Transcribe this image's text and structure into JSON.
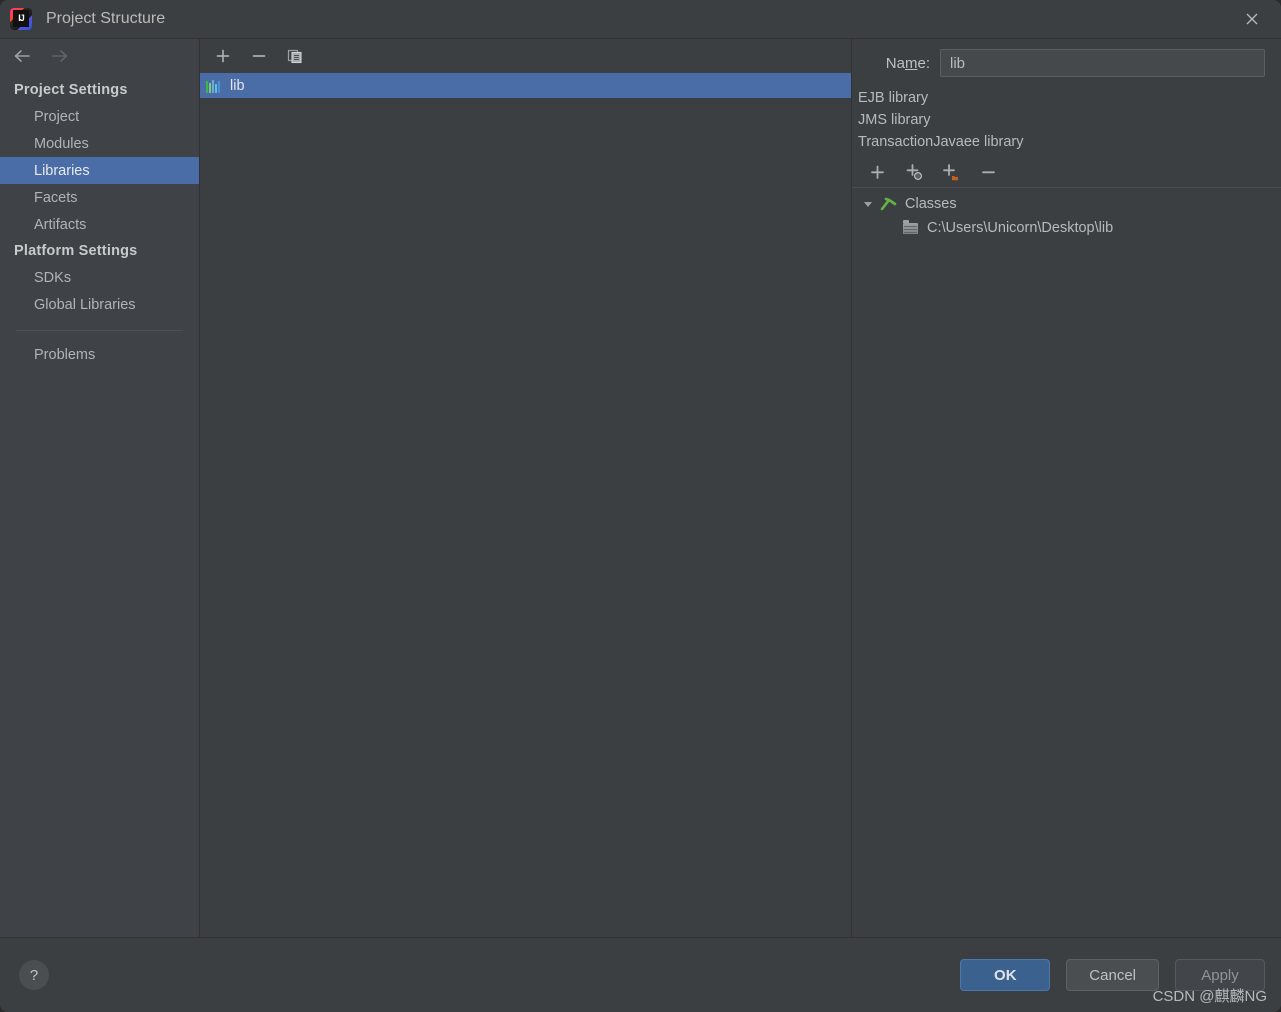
{
  "window": {
    "title": "Project Structure",
    "app_icon": "intellij-idea-logo",
    "close_icon": "close-icon"
  },
  "navigation": {
    "back_icon": "arrow-left-icon",
    "forward_icon": "arrow-right-icon"
  },
  "sidebar": {
    "groups": [
      {
        "header": "Project Settings",
        "items": [
          {
            "label": "Project",
            "selected": false
          },
          {
            "label": "Modules",
            "selected": false
          },
          {
            "label": "Libraries",
            "selected": true
          },
          {
            "label": "Facets",
            "selected": false
          },
          {
            "label": "Artifacts",
            "selected": false
          }
        ]
      },
      {
        "header": "Platform Settings",
        "items": [
          {
            "label": "SDKs",
            "selected": false
          },
          {
            "label": "Global Libraries",
            "selected": false
          }
        ]
      }
    ],
    "problems": "Problems"
  },
  "center": {
    "toolbar": [
      {
        "name": "add-library-button",
        "icon": "plus-icon"
      },
      {
        "name": "remove-library-button",
        "icon": "minus-icon"
      },
      {
        "name": "copy-library-button",
        "icon": "copy-icon"
      }
    ],
    "libraries": [
      {
        "label": "lib",
        "icon": "books-icon",
        "selected": true
      }
    ]
  },
  "details": {
    "name_label_prefix": "Na",
    "name_label_mnemonic": "m",
    "name_label_suffix": "e:",
    "name_value": "lib",
    "name_placeholder": "",
    "library_types": [
      "EJB library",
      "JMS library",
      "TransactionJavaee library"
    ],
    "toolbar": [
      {
        "name": "add-button",
        "icon": "plus-icon"
      },
      {
        "name": "attach-files-button",
        "icon": "plus-circle-icon"
      },
      {
        "name": "attach-directories-button",
        "icon": "plus-folder-icon"
      },
      {
        "name": "remove-button",
        "icon": "minus-icon"
      }
    ],
    "tree": {
      "root_label": "Classes",
      "root_icon": "classes-icon",
      "root_expanded_icon": "triangle-down-icon",
      "children": [
        {
          "label": "C:\\Users\\Unicorn\\Desktop\\lib",
          "icon": "folder-icon"
        }
      ]
    }
  },
  "footer": {
    "help_label": "?",
    "ok_label": "OK",
    "cancel_label": "Cancel",
    "apply_label": "Apply"
  },
  "watermark": "CSDN @麒麟NG",
  "colors": {
    "window_bg": "#3c3f41",
    "sidebar_bg": "#3f4347",
    "selection_blue": "#4a6da7",
    "primary_button": "#3b618f",
    "text": "#b7bbbe",
    "classes_green": "#62b543",
    "folder_orange": "#c5601d"
  }
}
